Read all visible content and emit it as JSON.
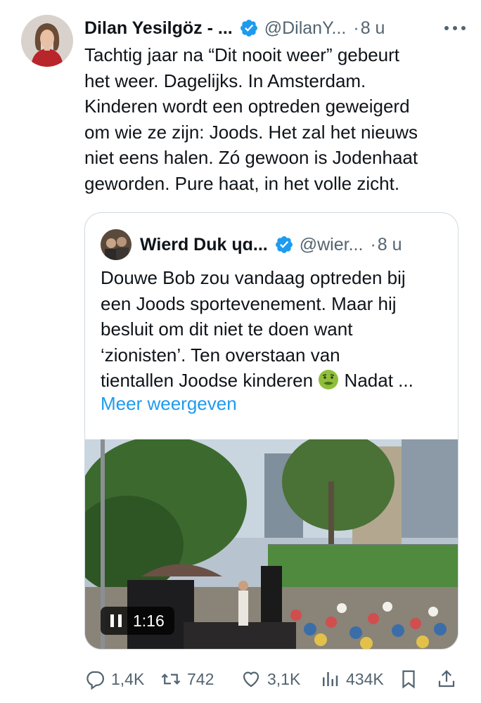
{
  "tweet": {
    "author_name": "Dilan Yesilgöz - ...",
    "author_handle": "@DilanY...",
    "dot": "·",
    "time": "8 u",
    "text": "Tachtig jaar na “Dit nooit weer” gebeurt\nhet weer. Dagelijks. In Amsterdam.\nKinderen wordt een optreden geweigerd\nom wie ze zijn: Joods. Het zal het nieuws\nniet eens halen. Zó gewoon is Jodenhaat\ngeworden. Pure haat, in het volle zicht."
  },
  "quote": {
    "author_name": "Wierd Duk ",
    "author_name_suffix": "ɥɑ...",
    "author_handle": "@wier...",
    "dot": "·",
    "time": "8 u",
    "text_main": "Douwe Bob zou vandaag optreden bij\neen Joods sportevenement. Maar hij\nbesluit om dit niet te doen want\n‘zionisten’. Ten overstaan van\ntientallen Joodse kinderen ",
    "text_tail": " Nadat ...",
    "emoji": "nauseated-face-icon",
    "show_more": "Meer weergeven",
    "video_time": "1:16"
  },
  "actions": {
    "replies": "1,4K",
    "reposts": "742",
    "likes": "3,1K",
    "views": "434K"
  },
  "colors": {
    "link": "#1d9bf0",
    "verified": "#1d9bf0",
    "secondary_text": "#536471",
    "border": "#cfd9de"
  }
}
